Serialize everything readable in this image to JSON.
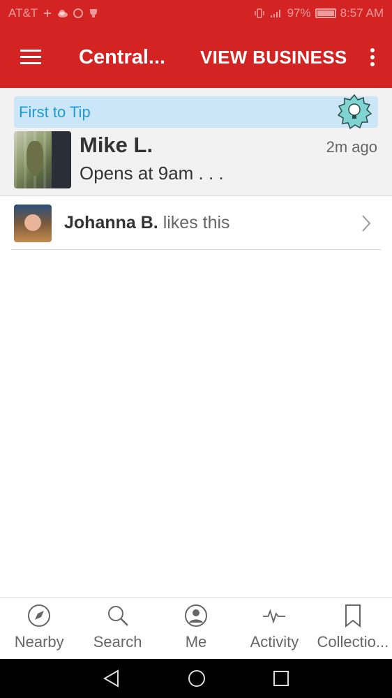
{
  "status_bar": {
    "carrier": "AT&T",
    "battery": "97%",
    "time": "8:57 AM"
  },
  "app_bar": {
    "title": "Central...",
    "view_business_label": "VIEW BUSINESS"
  },
  "tip": {
    "banner_label": "First to Tip",
    "user_name": "Mike L.",
    "time_ago": "2m ago",
    "text": "Opens at 9am . . ."
  },
  "likes": {
    "user_name": "Johanna B.",
    "suffix": " likes this"
  },
  "bottom_nav": {
    "items": [
      {
        "label": "Nearby",
        "icon": "compass-icon"
      },
      {
        "label": "Search",
        "icon": "search-icon"
      },
      {
        "label": "Me",
        "icon": "profile-icon"
      },
      {
        "label": "Activity",
        "icon": "activity-icon"
      },
      {
        "label": "Collectio...",
        "icon": "bookmark-icon"
      }
    ]
  },
  "colors": {
    "brand_red": "#d32323",
    "tip_banner_bg": "#cbe7f7",
    "tip_banner_text": "#1c9bd6"
  }
}
